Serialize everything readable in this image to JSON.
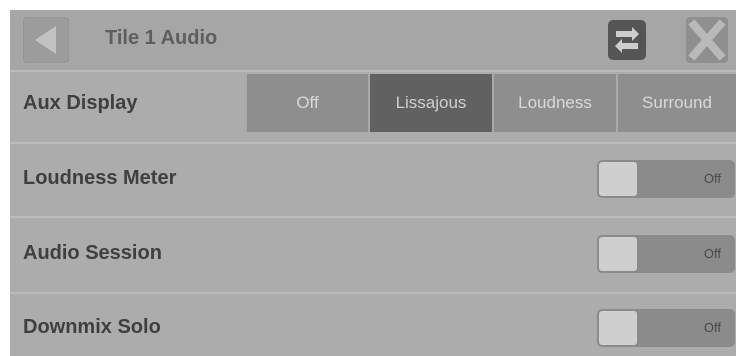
{
  "header": {
    "title": "Tile 1 Audio"
  },
  "icons": {
    "back": "back-arrow-icon",
    "swap": "swap-arrows-icon",
    "close": "close-x-icon"
  },
  "aux_display": {
    "label": "Aux Display",
    "options": [
      "Off",
      "Lissajous",
      "Loudness",
      "Surround"
    ],
    "selected": "Lissajous"
  },
  "settings": [
    {
      "label": "Loudness Meter",
      "state": "Off"
    },
    {
      "label": "Audio Session",
      "state": "Off"
    },
    {
      "label": "Downmix Solo",
      "state": "Off"
    }
  ],
  "colors": {
    "panel": "#a9a9a9",
    "segment": "#8e8e8e",
    "segment_selected": "#616161"
  }
}
